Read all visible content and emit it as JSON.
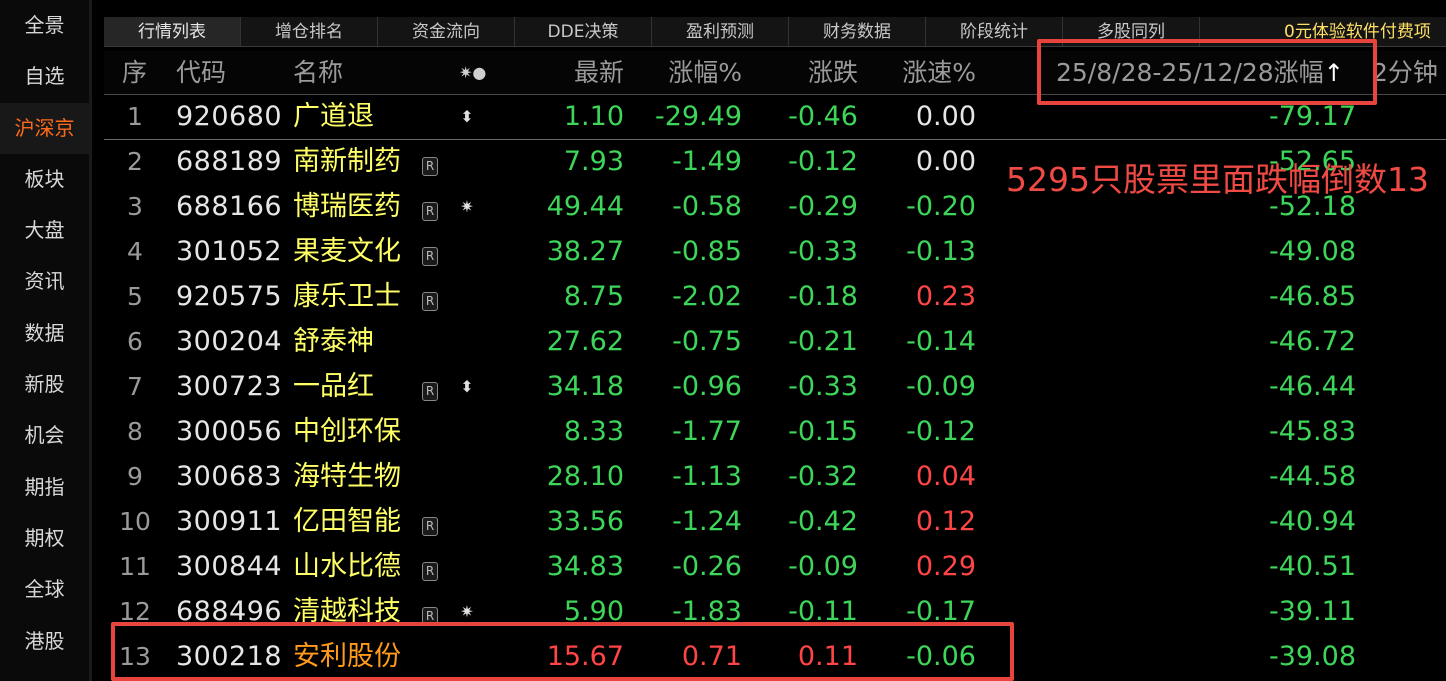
{
  "sidebar": {
    "items": [
      {
        "label": "全景",
        "active": false
      },
      {
        "label": "自选",
        "active": false
      },
      {
        "label": "沪深京",
        "active": true
      },
      {
        "label": "板块",
        "active": false
      },
      {
        "label": "大盘",
        "active": false
      },
      {
        "label": "资讯",
        "active": false
      },
      {
        "label": "数据",
        "active": false
      },
      {
        "label": "新股",
        "active": false
      },
      {
        "label": "机会",
        "active": false
      },
      {
        "label": "期指",
        "active": false
      },
      {
        "label": "期权",
        "active": false
      },
      {
        "label": "全球",
        "active": false
      },
      {
        "label": "港股",
        "active": false
      }
    ]
  },
  "tabs": [
    {
      "label": "行情列表",
      "active": true
    },
    {
      "label": "增仓排名",
      "active": false
    },
    {
      "label": "资金流向",
      "active": false
    },
    {
      "label": "DDE决策",
      "active": false
    },
    {
      "label": "盈利预测",
      "active": false
    },
    {
      "label": "财务数据",
      "active": false
    },
    {
      "label": "阶段统计",
      "active": false
    },
    {
      "label": "多股同列",
      "active": false
    }
  ],
  "promo": "0元体验软件付费项",
  "header": {
    "idx": "序",
    "code": "代码",
    "name": "名称",
    "flags": "✷●",
    "last": "最新",
    "pct": "涨幅%",
    "chg": "涨跌",
    "spd": "涨速%",
    "range": "25/8/28-25/12/28涨幅",
    "range_arrow": "↑",
    "next": "2分钟"
  },
  "rows": [
    {
      "idx": "1",
      "code": "920680",
      "name": "广道退",
      "r": false,
      "mark": "⬍",
      "last": "1.10",
      "pct": "-29.49",
      "chg": "-0.46",
      "spd": "0.00",
      "range": "-79.17",
      "last_c": "green",
      "pct_c": "green",
      "chg_c": "green",
      "spd_c": "white"
    },
    {
      "idx": "2",
      "code": "688189",
      "name": "南新制药",
      "r": true,
      "mark": "",
      "last": "7.93",
      "pct": "-1.49",
      "chg": "-0.12",
      "spd": "0.00",
      "range": "-52.65",
      "last_c": "green",
      "pct_c": "green",
      "chg_c": "green",
      "spd_c": "white"
    },
    {
      "idx": "3",
      "code": "688166",
      "name": "博瑞医药",
      "r": true,
      "mark": "✷",
      "last": "49.44",
      "pct": "-0.58",
      "chg": "-0.29",
      "spd": "-0.20",
      "range": "-52.18",
      "last_c": "green",
      "pct_c": "green",
      "chg_c": "green",
      "spd_c": "green"
    },
    {
      "idx": "4",
      "code": "301052",
      "name": "果麦文化",
      "r": true,
      "mark": "",
      "last": "38.27",
      "pct": "-0.85",
      "chg": "-0.33",
      "spd": "-0.13",
      "range": "-49.08",
      "last_c": "green",
      "pct_c": "green",
      "chg_c": "green",
      "spd_c": "green"
    },
    {
      "idx": "5",
      "code": "920575",
      "name": "康乐卫士",
      "r": true,
      "mark": "",
      "last": "8.75",
      "pct": "-2.02",
      "chg": "-0.18",
      "spd": "0.23",
      "range": "-46.85",
      "last_c": "green",
      "pct_c": "green",
      "chg_c": "green",
      "spd_c": "red"
    },
    {
      "idx": "6",
      "code": "300204",
      "name": "舒泰神",
      "r": false,
      "mark": "",
      "last": "27.62",
      "pct": "-0.75",
      "chg": "-0.21",
      "spd": "-0.14",
      "range": "-46.72",
      "last_c": "green",
      "pct_c": "green",
      "chg_c": "green",
      "spd_c": "green"
    },
    {
      "idx": "7",
      "code": "300723",
      "name": "一品红",
      "r": true,
      "mark": "⬍",
      "last": "34.18",
      "pct": "-0.96",
      "chg": "-0.33",
      "spd": "-0.09",
      "range": "-46.44",
      "last_c": "green",
      "pct_c": "green",
      "chg_c": "green",
      "spd_c": "green"
    },
    {
      "idx": "8",
      "code": "300056",
      "name": "中创环保",
      "r": false,
      "mark": "",
      "last": "8.33",
      "pct": "-1.77",
      "chg": "-0.15",
      "spd": "-0.12",
      "range": "-45.83",
      "last_c": "green",
      "pct_c": "green",
      "chg_c": "green",
      "spd_c": "green"
    },
    {
      "idx": "9",
      "code": "300683",
      "name": "海特生物",
      "r": false,
      "mark": "",
      "last": "28.10",
      "pct": "-1.13",
      "chg": "-0.32",
      "spd": "0.04",
      "range": "-44.58",
      "last_c": "green",
      "pct_c": "green",
      "chg_c": "green",
      "spd_c": "red"
    },
    {
      "idx": "10",
      "code": "300911",
      "name": "亿田智能",
      "r": true,
      "mark": "",
      "last": "33.56",
      "pct": "-1.24",
      "chg": "-0.42",
      "spd": "0.12",
      "range": "-40.94",
      "last_c": "green",
      "pct_c": "green",
      "chg_c": "green",
      "spd_c": "red"
    },
    {
      "idx": "11",
      "code": "300844",
      "name": "山水比德",
      "r": true,
      "mark": "",
      "last": "34.83",
      "pct": "-0.26",
      "chg": "-0.09",
      "spd": "0.29",
      "range": "-40.51",
      "last_c": "green",
      "pct_c": "green",
      "chg_c": "green",
      "spd_c": "red"
    },
    {
      "idx": "12",
      "code": "688496",
      "name": "清越科技",
      "r": true,
      "mark": "✷",
      "last": "5.90",
      "pct": "-1.83",
      "chg": "-0.11",
      "spd": "-0.17",
      "range": "-39.11",
      "last_c": "green",
      "pct_c": "green",
      "chg_c": "green",
      "spd_c": "green"
    },
    {
      "idx": "13",
      "code": "300218",
      "name": "安利股份",
      "r": false,
      "mark": "",
      "last": "15.67",
      "pct": "0.71",
      "chg": "0.11",
      "spd": "-0.06",
      "range": "-39.08",
      "last_c": "red",
      "pct_c": "red",
      "chg_c": "red",
      "spd_c": "green",
      "highlight": true
    }
  ],
  "annotation": {
    "text": "5295只股票里面跌幅倒数13",
    "color": "#e8443e"
  },
  "colors": {
    "up": "#ff4545",
    "down": "#3dd65a",
    "name": "#ffff66",
    "active_sidebar": "#ff6a1a"
  }
}
